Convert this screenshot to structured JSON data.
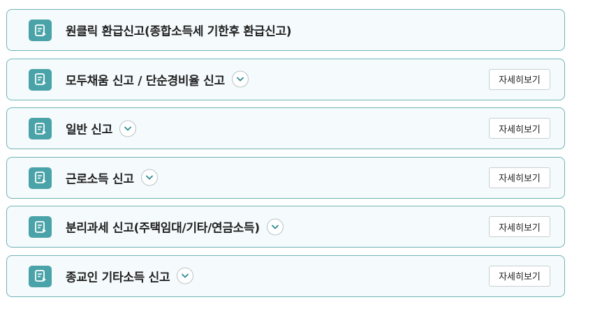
{
  "items": [
    {
      "title": "원클릭 환급신고(종합소득세 기한후 환급신고)",
      "has_toggle": false,
      "has_detail": false
    },
    {
      "title": "모두채움 신고 / 단순경비율 신고",
      "has_toggle": true,
      "has_detail": true,
      "detail_label": "자세히보기"
    },
    {
      "title": "일반 신고",
      "has_toggle": true,
      "has_detail": true,
      "detail_label": "자세히보기"
    },
    {
      "title": "근로소득 신고",
      "has_toggle": true,
      "has_detail": true,
      "detail_label": "자세히보기"
    },
    {
      "title": "분리과세 신고(주택임대/기타/연금소득)",
      "has_toggle": true,
      "has_detail": true,
      "detail_label": "자세히보기"
    },
    {
      "title": "종교인 기타소득 신고",
      "has_toggle": true,
      "has_detail": true,
      "detail_label": "자세히보기"
    }
  ],
  "icons": {
    "item_icon": "document-play-icon",
    "toggle_icon": "chevron-down-icon"
  },
  "colors": {
    "card_border": "#6fb3b6",
    "card_background": "#f5fbfc",
    "icon_background": "#4aa3a8",
    "chevron": "#2f8a90"
  }
}
